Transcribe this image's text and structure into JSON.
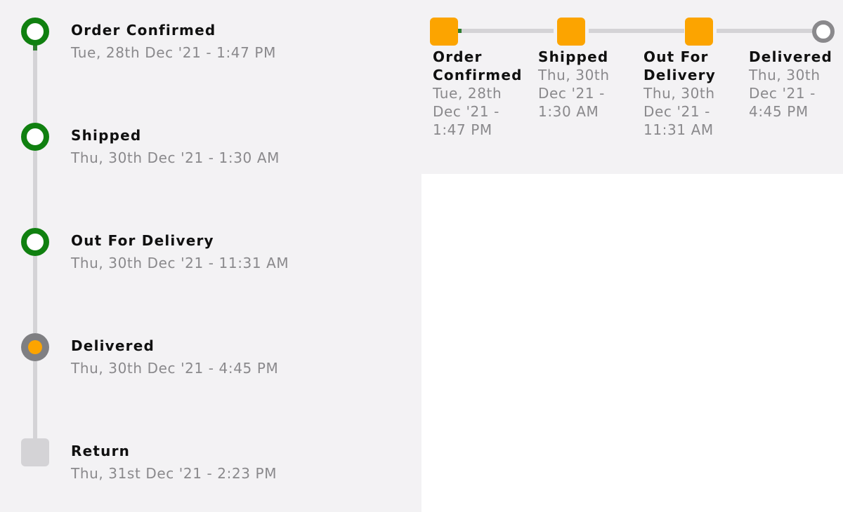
{
  "vertical_timeline": {
    "steps": [
      {
        "title": "Order Confirmed",
        "date": "Tue, 28th Dec '21 - 1:47 PM",
        "state": "completed"
      },
      {
        "title": "Shipped",
        "date": "Thu, 30th Dec '21 - 1:30 AM",
        "state": "completed"
      },
      {
        "title": "Out For Delivery",
        "date": "Thu, 30th Dec '21 - 11:31 AM",
        "state": "completed"
      },
      {
        "title": "Delivered",
        "date": "Thu, 30th Dec '21 - 4:45 PM",
        "state": "current"
      },
      {
        "title": "Return",
        "date": "Thu, 31st Dec '21 - 2:23 PM",
        "state": "pending"
      }
    ]
  },
  "horizontal_stepper": {
    "steps": [
      {
        "title": "Order Confirmed",
        "date": "Tue, 28th Dec '21 - 1:47 PM",
        "state": "completed"
      },
      {
        "title": "Shipped",
        "date": "Thu, 30th Dec '21 - 1:30 AM",
        "state": "completed"
      },
      {
        "title": "Out For Delivery",
        "date": "Thu, 30th Dec '21 - 11:31 AM",
        "state": "completed"
      },
      {
        "title": "Delivered",
        "date": "Thu, 30th Dec '21 - 4:45 PM",
        "state": "pending"
      }
    ]
  },
  "colors": {
    "panel_background": "#f3f2f4",
    "completed_green": "#108010",
    "progress_green": "#2f7d2f",
    "active_orange": "#fca400",
    "pending_gray": "#8a898c",
    "track_gray": "#d4d3d6",
    "title_text": "#101010",
    "date_text": "#8a898c"
  }
}
